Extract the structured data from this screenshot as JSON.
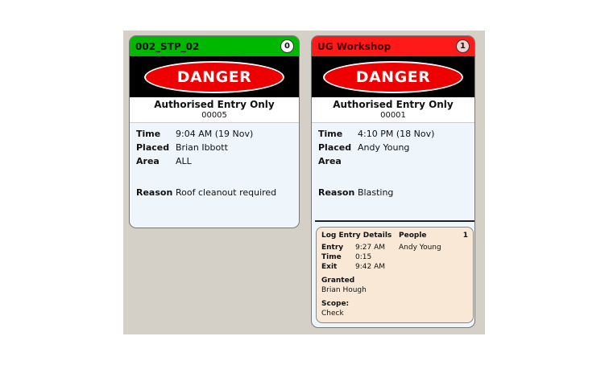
{
  "cards": [
    {
      "header": "002_STP_02",
      "count": "0",
      "banner": "DANGER",
      "title": "Authorised Entry Only",
      "code": "00005",
      "fields": {
        "time_label": "Time",
        "time": "9:04 AM (19 Nov)",
        "placed_label": "Placed",
        "placed": "Brian Ibbott",
        "area_label": "Area",
        "area": "ALL",
        "reason_label": "Reason",
        "reason": "Roof cleanout required"
      },
      "colors": {
        "header": "#00b800"
      }
    },
    {
      "header": "UG Workshop",
      "count": "1",
      "banner": "DANGER",
      "title": "Authorised Entry Only",
      "code": "00001",
      "fields": {
        "time_label": "Time",
        "time": "4:10 PM (18 Nov)",
        "placed_label": "Placed",
        "placed": "Andy Young",
        "area_label": "Area",
        "area": "",
        "reason_label": "Reason",
        "reason": "Blasting"
      },
      "colors": {
        "header": "#ff1a1a"
      },
      "log": {
        "heading": "Log Entry Details",
        "people_label": "People",
        "people_count": "1",
        "entry_label": "Entry",
        "entry": "9:27 AM",
        "time_label": "Time",
        "time": "0:15",
        "exit_label": "Exit",
        "exit": "9:42 AM",
        "person": "Andy Young",
        "granted_label": "Granted",
        "granted": "Brian Hough",
        "scope_label": "Scope:",
        "scope": "Check"
      }
    }
  ]
}
